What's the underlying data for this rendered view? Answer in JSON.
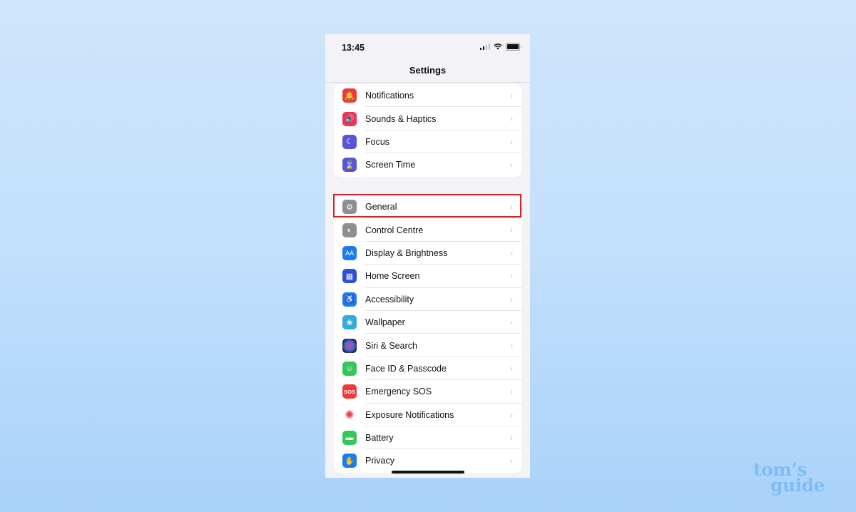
{
  "status_bar": {
    "time": "13:45",
    "icons": [
      "cellular-signal-icon",
      "wifi-icon",
      "battery-icon"
    ]
  },
  "header": {
    "title": "Settings"
  },
  "groups": [
    {
      "items": [
        {
          "label": "Notifications",
          "icon": "bell-icon",
          "color": "#f03a3a",
          "glyph": "🔔"
        },
        {
          "label": "Sounds & Haptics",
          "icon": "speaker-icon",
          "color": "#f0325a",
          "glyph": "🔊"
        },
        {
          "label": "Focus",
          "icon": "moon-icon",
          "color": "#5a55d6",
          "glyph": "☾"
        },
        {
          "label": "Screen Time",
          "icon": "hourglass-icon",
          "color": "#5a55d6",
          "glyph": "⌛"
        }
      ]
    },
    {
      "items": [
        {
          "label": "General",
          "icon": "gear-icon",
          "color": "#8e8e93",
          "glyph": "⚙"
        },
        {
          "label": "Control Centre",
          "icon": "toggles-icon",
          "color": "#8e8e93",
          "glyph": "◐"
        },
        {
          "label": "Display & Brightness",
          "icon": "text-size-icon",
          "color": "#1a7cf0",
          "glyph": "AA"
        },
        {
          "label": "Home Screen",
          "icon": "app-grid-icon",
          "color": "#2f4ee0",
          "glyph": "▦"
        },
        {
          "label": "Accessibility",
          "icon": "accessibility-icon",
          "color": "#1a7cf0",
          "glyph": "♿"
        },
        {
          "label": "Wallpaper",
          "icon": "flower-icon",
          "color": "#35aadc",
          "glyph": "❀"
        },
        {
          "label": "Siri & Search",
          "icon": "siri-icon",
          "color": "#2a1a3a",
          "glyph": "●"
        },
        {
          "label": "Face ID & Passcode",
          "icon": "face-id-icon",
          "color": "#34c759",
          "glyph": "☺"
        },
        {
          "label": "Emergency SOS",
          "icon": "sos-icon",
          "color": "#f03a3a",
          "glyph": "SOS"
        },
        {
          "label": "Exposure Notifications",
          "icon": "exposure-icon",
          "color": "#ffffff",
          "glyph": "✺"
        },
        {
          "label": "Battery",
          "icon": "battery-setting-icon",
          "color": "#34c759",
          "glyph": "▬"
        },
        {
          "label": "Privacy",
          "icon": "hand-icon",
          "color": "#1a7cf0",
          "glyph": "✋"
        }
      ]
    }
  ],
  "highlighted_item": "General",
  "highlight_color": "#d2232a",
  "watermark": {
    "line1": "tom’s",
    "line2": "guide"
  }
}
